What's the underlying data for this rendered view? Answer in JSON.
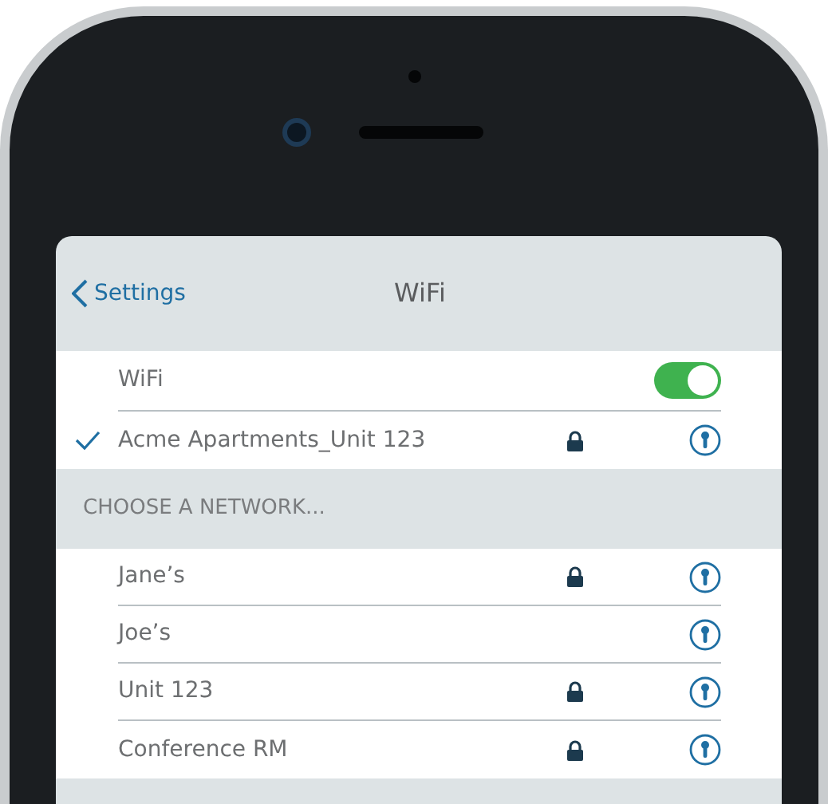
{
  "nav": {
    "back": "Settings",
    "title": "WiFi"
  },
  "wifi": {
    "label": "WiFi",
    "on": true
  },
  "current": [
    {
      "name": "Acme Apartments_Unit 123",
      "selected": true,
      "locked": true
    }
  ],
  "section_header": "CHOOSE A NETWORK...",
  "networks": [
    {
      "name": "Jane’s",
      "locked": true
    },
    {
      "name": "Joe’s",
      "locked": false
    },
    {
      "name": "Unit 123",
      "locked": true
    },
    {
      "name": "Conference RM",
      "locked": true
    }
  ]
}
